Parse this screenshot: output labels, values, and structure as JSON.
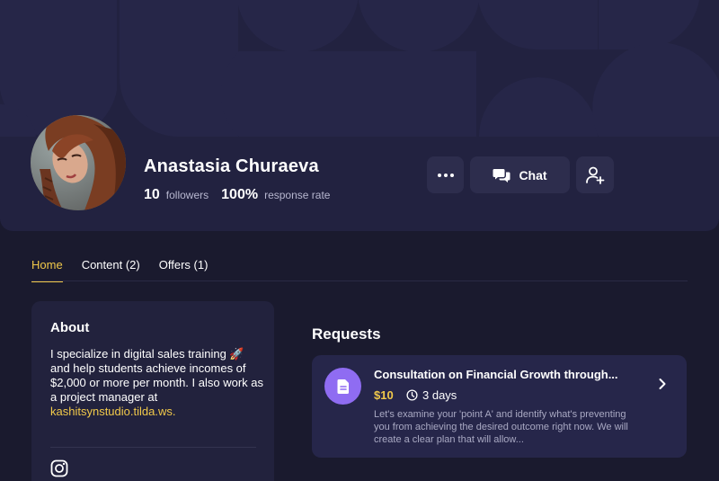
{
  "profile": {
    "name": "Anastasia Churaeva",
    "followers_count": "10",
    "followers_label": "followers",
    "response_rate": "100%",
    "response_label": "response rate"
  },
  "actions": {
    "more_icon": "more-dots-icon",
    "chat_label": "Chat",
    "chat_icon": "chat-bubbles-icon",
    "follow_icon": "add-user-icon"
  },
  "tabs": [
    {
      "label": "Home",
      "active": true
    },
    {
      "label": "Content (2)",
      "active": false
    },
    {
      "label": "Offers (1)",
      "active": false
    }
  ],
  "about": {
    "title": "About",
    "text": "I specialize in digital sales training 🚀 and help students achieve incomes of $2,000 or more per month. I also work as a project manager at ",
    "link": "kashitsynstudio.tilda.ws.",
    "social_icon": "instagram-icon"
  },
  "requests": {
    "title": "Requests",
    "items": [
      {
        "name": "Consultation on Financial Growth through...",
        "price": "$10",
        "duration": "3 days",
        "description": "Let's examine your 'point A' and identify what's preventing you from achieving the desired outcome right now. We will create a clear plan that will allow..."
      }
    ]
  },
  "colors": {
    "background": "#1a1a2e",
    "cover": "#222240",
    "accent": "#f1c94a",
    "request_icon": "#8f6cf2"
  }
}
